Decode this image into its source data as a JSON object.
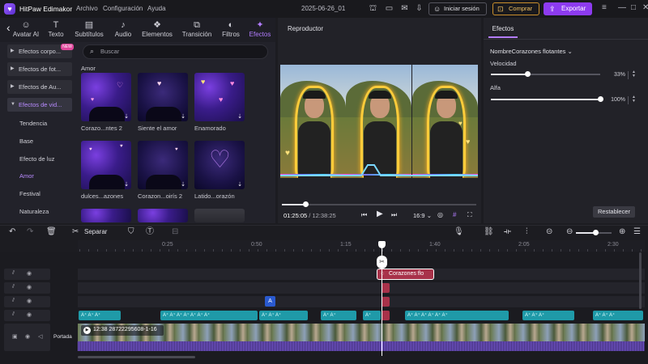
{
  "app": {
    "title": "HitPaw Edimakor",
    "document_title": "2025-06-26_01"
  },
  "menu": [
    "Archivo",
    "Configuración",
    "Ayuda"
  ],
  "header": {
    "login_label": "Iniciar sesión",
    "buy_label": "Comprar",
    "export_label": "Exportar"
  },
  "tabs": [
    {
      "label": "Avatar AI",
      "icon": "avatar-icon"
    },
    {
      "label": "Texto",
      "icon": "text-icon"
    },
    {
      "label": "Subtítulos",
      "icon": "subtitles-icon"
    },
    {
      "label": "Audio",
      "icon": "audio-icon"
    },
    {
      "label": "Elementos",
      "icon": "elements-icon"
    },
    {
      "label": "Transición",
      "icon": "transition-icon"
    },
    {
      "label": "Filtros",
      "icon": "filters-icon"
    },
    {
      "label": "Efectos",
      "icon": "effects-icon",
      "active": true
    }
  ],
  "categories": [
    {
      "label": "Efectos corpo...",
      "badge": "NEW"
    },
    {
      "label": "Efectos de fot..."
    },
    {
      "label": "Efectos de Au..."
    },
    {
      "label": "Efectos de vid...",
      "open": true
    }
  ],
  "subcategories": [
    "Tendencia",
    "Base",
    "Efecto de luz",
    "Amor",
    "Festival",
    "Naturaleza"
  ],
  "active_subcategory": "Amor",
  "search": {
    "placeholder": "Buscar"
  },
  "section_title": "Amor",
  "effects": [
    {
      "label": "Corazo...ntes 2"
    },
    {
      "label": "Siente el amor"
    },
    {
      "label": "Enamorado"
    },
    {
      "label": "dulces...azones"
    },
    {
      "label": "Corazon...oirís 2"
    },
    {
      "label": "Latido...orazón"
    }
  ],
  "player": {
    "title": "Reproductor",
    "current_time": "01:25:05",
    "total_time": "12:38:25",
    "progress_fraction": 0.12,
    "aspect_ratio": "16:9"
  },
  "right_panel": {
    "tab": "Efectos",
    "effect_name": "NombreCorazones flotantes",
    "params": [
      {
        "label": "Velocidad",
        "value": "33%",
        "fraction": 0.33
      },
      {
        "label": "Alfa",
        "value": "100%",
        "fraction": 1.0
      }
    ],
    "reset_label": "Restablecer"
  },
  "timeline": {
    "split_label": "Separar",
    "ruler": [
      "0:25",
      "0:50",
      "1:15",
      "1:40",
      "2:05",
      "2:30"
    ],
    "zoom_fraction": 0.55,
    "effect_clip_label": "Corazones flo",
    "video_clip_name": "12:38 28722295608-1-16",
    "cover_label": "Portada"
  },
  "colors": {
    "accent": "#8d3bf0",
    "effect_clip": "#a8324a",
    "text_clip": "#1f9aa8",
    "audio": "#7a5ad8"
  }
}
